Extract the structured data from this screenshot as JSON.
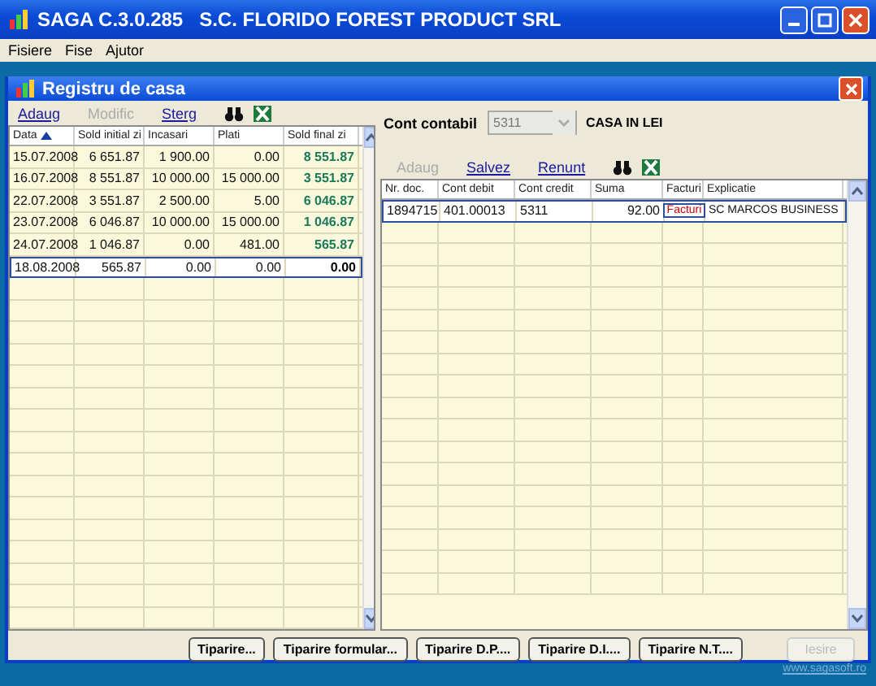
{
  "window": {
    "title": "SAGA C.3.0.285   S.C. FLORIDO FOREST PRODUCT SRL"
  },
  "menu": [
    "Fisiere",
    "Fise",
    "Ajutor"
  ],
  "dialog": {
    "title": "Registru de casa"
  },
  "left_toolbar": [
    {
      "label": "Adaug",
      "disabled": false
    },
    {
      "label": "Modific",
      "disabled": true
    },
    {
      "label": "Sterg",
      "disabled": false
    }
  ],
  "left_table": {
    "columns": [
      "Data",
      "Sold initial zi",
      "Incasari",
      "Plati",
      "Sold final zi"
    ],
    "rows": [
      {
        "cells": [
          "15.07.2008",
          "6 651.87",
          "1 900.00",
          "0.00",
          "8 551.87"
        ],
        "selected": false
      },
      {
        "cells": [
          "16.07.2008",
          "8 551.87",
          "10 000.00",
          "15 000.00",
          "3 551.87"
        ],
        "selected": false
      },
      {
        "cells": [
          "22.07.2008",
          "3 551.87",
          "2 500.00",
          "5.00",
          "6 046.87"
        ],
        "selected": false
      },
      {
        "cells": [
          "23.07.2008",
          "6 046.87",
          "10 000.00",
          "15 000.00",
          "1 046.87"
        ],
        "selected": false
      },
      {
        "cells": [
          "24.07.2008",
          "1 046.87",
          "0.00",
          "481.00",
          "565.87"
        ],
        "selected": false
      },
      {
        "cells": [
          "18.08.2008",
          "565.87",
          "0.00",
          "0.00",
          "0.00"
        ],
        "selected": true
      }
    ]
  },
  "account": {
    "label": "Cont contabil",
    "value": "5311",
    "name": "CASA IN LEI"
  },
  "right_toolbar": [
    {
      "label": "Adaug",
      "disabled": true
    },
    {
      "label": "Salvez",
      "disabled": false
    },
    {
      "label": "Renunt",
      "disabled": false
    }
  ],
  "right_table": {
    "columns": [
      "Nr. doc.",
      "Cont debit",
      "Cont credit",
      "Suma",
      "Facturi",
      "Explicatie"
    ],
    "rows": [
      {
        "nr": "1894715",
        "debit": "401.00013",
        "credit": "5311",
        "suma": "92.00",
        "facturi": "Facturi",
        "explicatie": "SC MARCOS BUSINESS",
        "selected": true
      }
    ]
  },
  "buttons": [
    {
      "label": "Tiparire...",
      "disabled": false
    },
    {
      "label": "Tiparire formular...",
      "disabled": false
    },
    {
      "label": "Tiparire D.P....",
      "disabled": false
    },
    {
      "label": "Tiparire D.I....",
      "disabled": false
    },
    {
      "label": "Tiparire N.T....",
      "disabled": false
    },
    {
      "label": "Iesire",
      "disabled": true
    }
  ],
  "footer_link": "www.sagasoft.ro"
}
